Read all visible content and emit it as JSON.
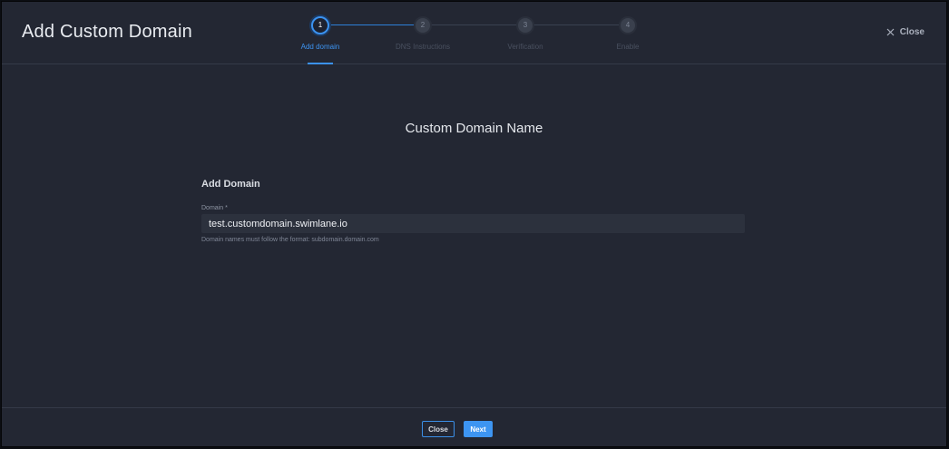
{
  "dialog": {
    "title": "Add Custom Domain",
    "close_label": "Close"
  },
  "stepper": {
    "steps": [
      {
        "number": "1",
        "label": "Add domain",
        "active": true
      },
      {
        "number": "2",
        "label": "DNS Instructions",
        "active": false
      },
      {
        "number": "3",
        "label": "Verification",
        "active": false
      },
      {
        "number": "4",
        "label": "Enable",
        "active": false
      }
    ]
  },
  "main": {
    "section_title": "Custom Domain Name",
    "form_heading": "Add Domain",
    "domain_field": {
      "label": "Domain *",
      "value": "test.customdomain.swimlane.io",
      "hint": "Domain names must follow the format: subdomain.domain.com"
    }
  },
  "footer": {
    "close_label": "Close",
    "next_label": "Next"
  },
  "colors": {
    "background": "#232733",
    "accent": "#3d95f2"
  }
}
